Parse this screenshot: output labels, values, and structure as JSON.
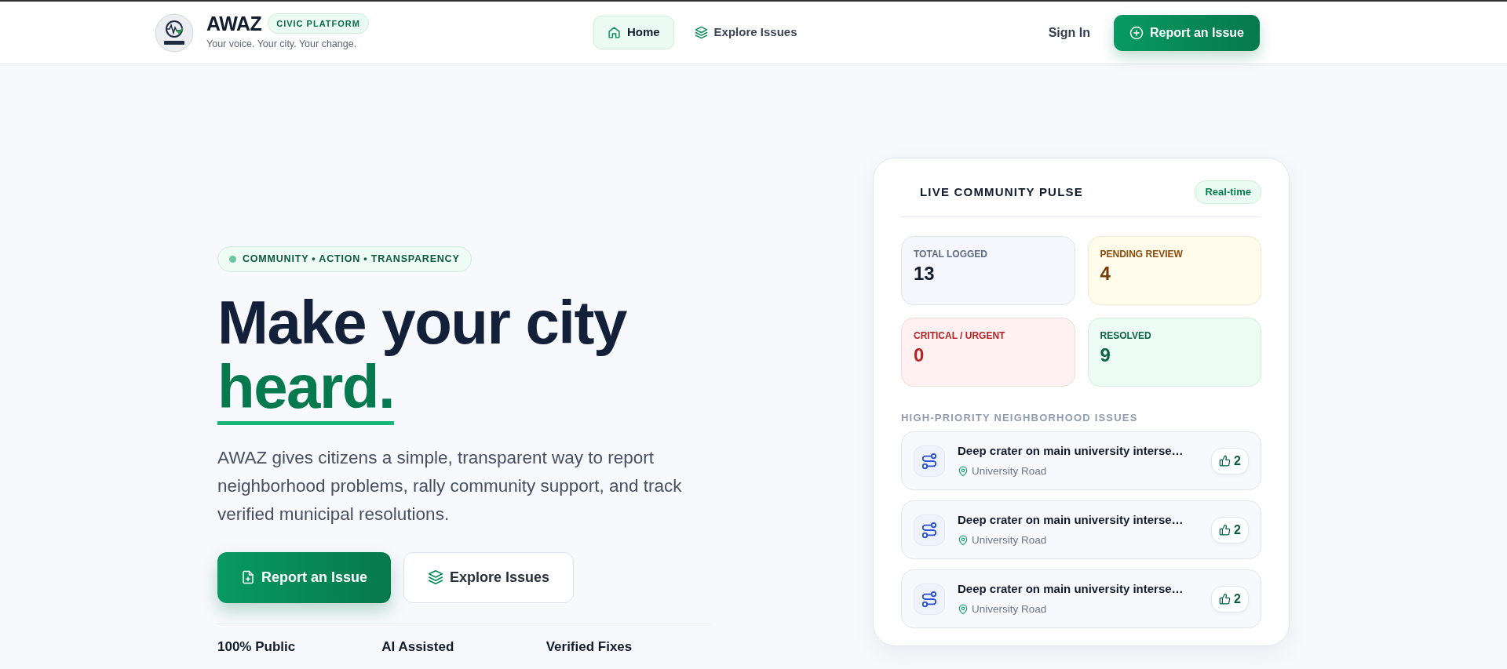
{
  "brand": {
    "name": "AWAZ",
    "tag": "CIVIC PLATFORM",
    "tagline": "Your voice. Your city. Your change."
  },
  "nav": [
    {
      "label": "Home",
      "selected": true
    },
    {
      "label": "Explore Issues",
      "selected": false
    }
  ],
  "actions": {
    "sign_in": "Sign In",
    "report": "Report an Issue"
  },
  "hero": {
    "eyebrow": "COMMUNITY • ACTION • TRANSPARENCY",
    "headline": "Make your city",
    "highlight": "heard.",
    "lead": "AWAZ gives citizens a simple, transparent way to report neighborhood problems, rally community support, and track verified municipal resolutions.",
    "buttons": [
      {
        "label": "Report an Issue",
        "kind": "primary"
      },
      {
        "label": "Explore Issues",
        "kind": "secondary"
      }
    ],
    "stats": [
      "100% Public",
      "AI Assisted",
      "Verified Fixes"
    ]
  },
  "pulse": {
    "title": "LIVE COMMUNITY PULSE",
    "badge": "Real-time",
    "tiles": [
      {
        "label": "TOTAL LOGGED",
        "value": "13",
        "kind": "neutral"
      },
      {
        "label": "PENDING REVIEW",
        "value": "4",
        "kind": "pending"
      },
      {
        "label": "CRITICAL / URGENT",
        "value": "0",
        "kind": "critical"
      },
      {
        "label": "RESOLVED",
        "value": "9",
        "kind": "resolved"
      }
    ],
    "section": "HIGH-PRIORITY NEIGHBORHOOD ISSUES",
    "issues": [
      {
        "title": "Deep crater on main university interse…",
        "location": "University Road",
        "votes": "2"
      },
      {
        "title": "Deep crater on main university interse…",
        "location": "University Road",
        "votes": "2"
      },
      {
        "title": "Deep crater on main university interse…",
        "location": "University Road",
        "votes": "2"
      }
    ]
  }
}
